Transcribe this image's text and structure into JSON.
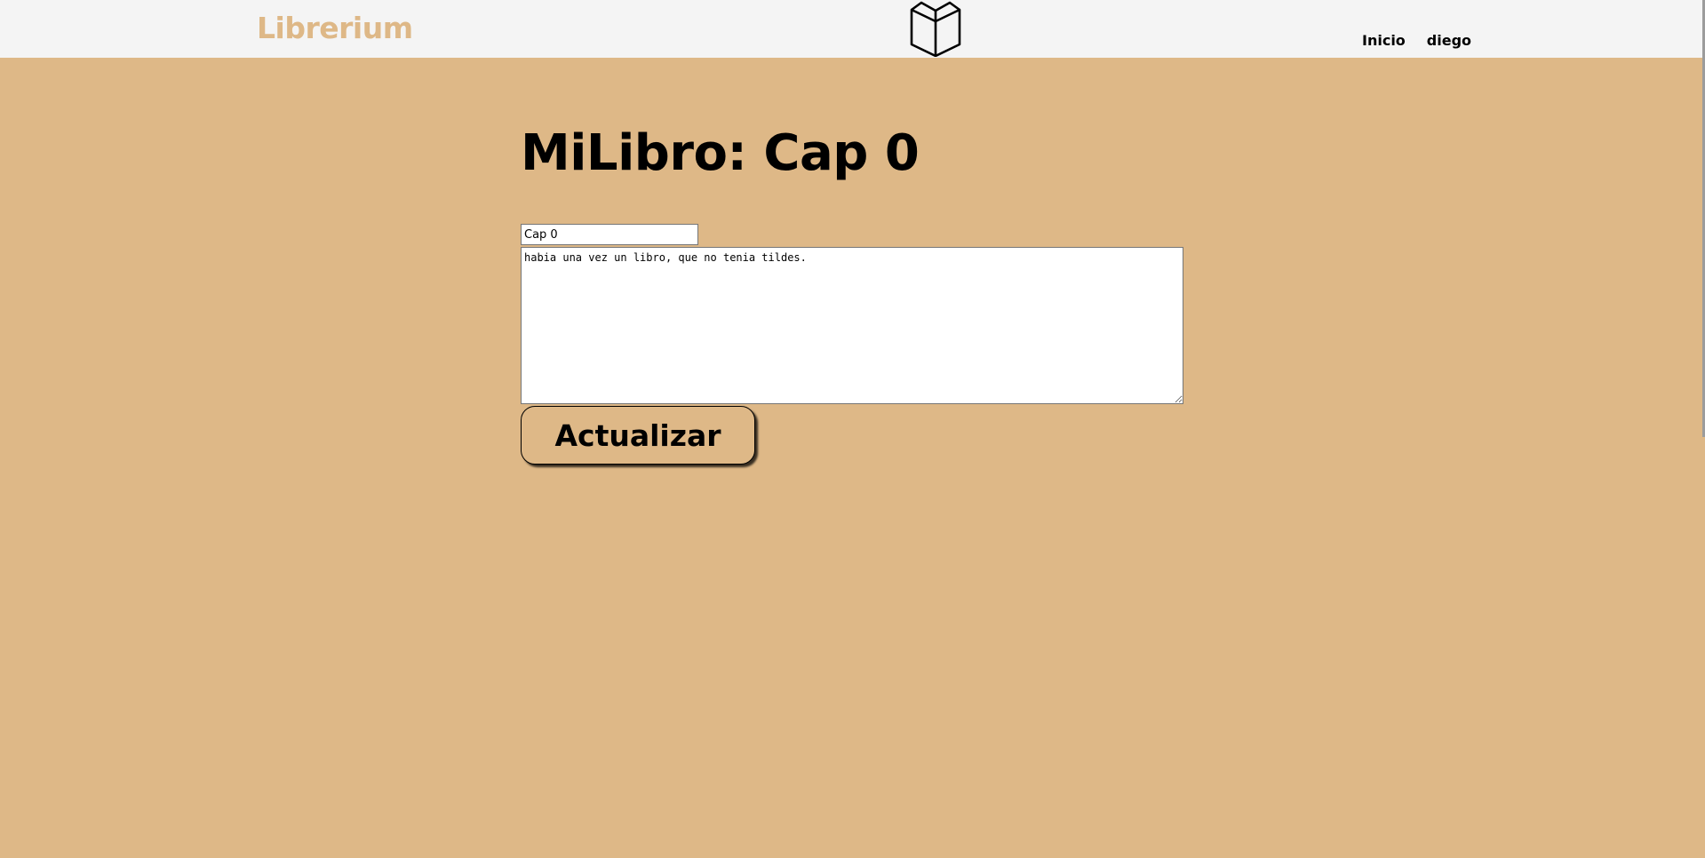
{
  "navbar": {
    "brand": "Librerium",
    "logo_icon": "open-book-icon",
    "links": [
      {
        "label": "Inicio"
      },
      {
        "label": "diego"
      }
    ]
  },
  "main": {
    "title": "MiLibro: Cap 0",
    "chapter_title_value": "Cap 0",
    "chapter_content_value": "habia una vez un libro, que no tenia tildes.",
    "submit_label": "Actualizar"
  },
  "colors": {
    "background": "#deb887",
    "navbar": "#f4f4f4",
    "brand": "#deb887"
  }
}
